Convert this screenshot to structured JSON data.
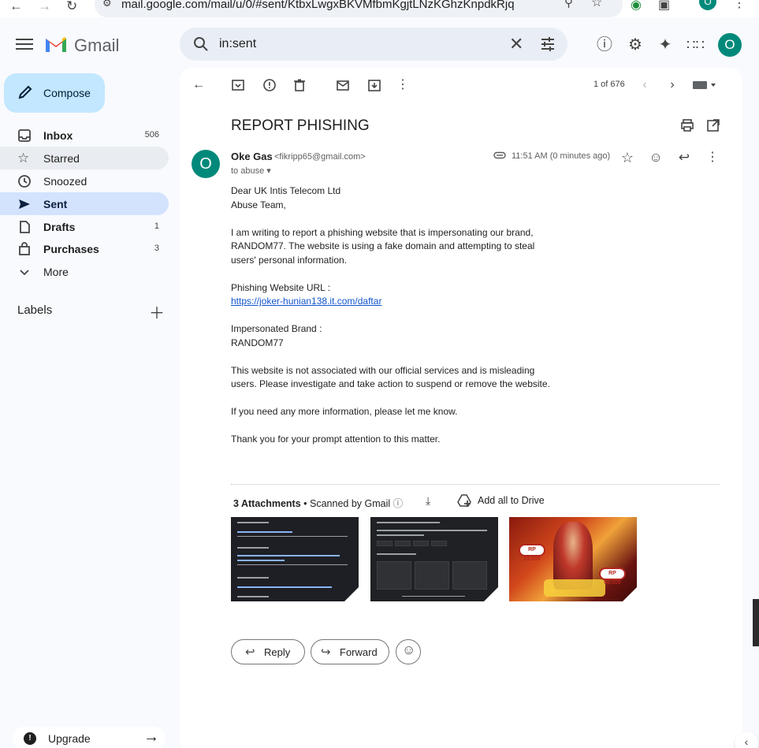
{
  "browser": {
    "url": "mail.google.com/mail/u/0/#sent/KtbxLwgxBKVMfbmKgjtLNzKGhzKnpdkRjq",
    "profile_initial": "O"
  },
  "app": {
    "name": "Gmail",
    "search_value": "in:sent",
    "account_initial": "O"
  },
  "sidebar": {
    "compose_label": "Compose",
    "items": [
      {
        "label": "Inbox",
        "count": "506",
        "icon": "inbox-icon"
      },
      {
        "label": "Starred",
        "count": "",
        "icon": "star-icon"
      },
      {
        "label": "Snoozed",
        "count": "",
        "icon": "clock-icon"
      },
      {
        "label": "Sent",
        "count": "",
        "icon": "send-icon"
      },
      {
        "label": "Drafts",
        "count": "1",
        "icon": "draft-icon"
      },
      {
        "label": "Purchases",
        "count": "3",
        "icon": "shopping-bag-icon"
      },
      {
        "label": "More",
        "count": "",
        "icon": "chevron-down-icon"
      }
    ],
    "labels_title": "Labels",
    "upgrade_label": "Upgrade"
  },
  "toolbar": {
    "pager": "1 of 676"
  },
  "email": {
    "subject": "REPORT PHISHING",
    "sender_initial": "O",
    "sender_name": "Oke Gas",
    "sender_email": "<fikripp65@gmail.com>",
    "to": "to abuse",
    "time": "11:51 AM (0 minutes ago)",
    "body": {
      "greeting_1": "Dear UK Intis Telecom Ltd",
      "greeting_2": "Abuse Team,",
      "para1": "I am writing to report a phishing website that is impersonating our brand, RANDOM77. The website is using a fake domain and attempting to steal users' personal information.",
      "url_label": "Phishing Website URL :",
      "url": "https://joker-hunian138.it.com/daftar",
      "brand_label": "Impersonated Brand :",
      "brand": "RANDOM77",
      "para2": "This website is not associated with our official services and is misleading users. Please investigate and take action to suspend or remove the website.",
      "para3": "If you need any more information, please let me know.",
      "para4": "Thank you for your prompt attention to this matter."
    },
    "attachments": {
      "count_label": "3 Attachments",
      "scan_label": "Scanned by Gmail",
      "add_all_label": "Add all to Drive",
      "badge_1": "RP 10.000",
      "badge_2": "RP 50.000"
    },
    "reply_label": "Reply",
    "forward_label": "Forward"
  },
  "colors": {
    "accent": "#0b57d0",
    "compose_bg": "#c2e7ff",
    "active_nav_bg": "#d3e3fd",
    "avatar": "#00897b",
    "link": "#1155cc"
  }
}
